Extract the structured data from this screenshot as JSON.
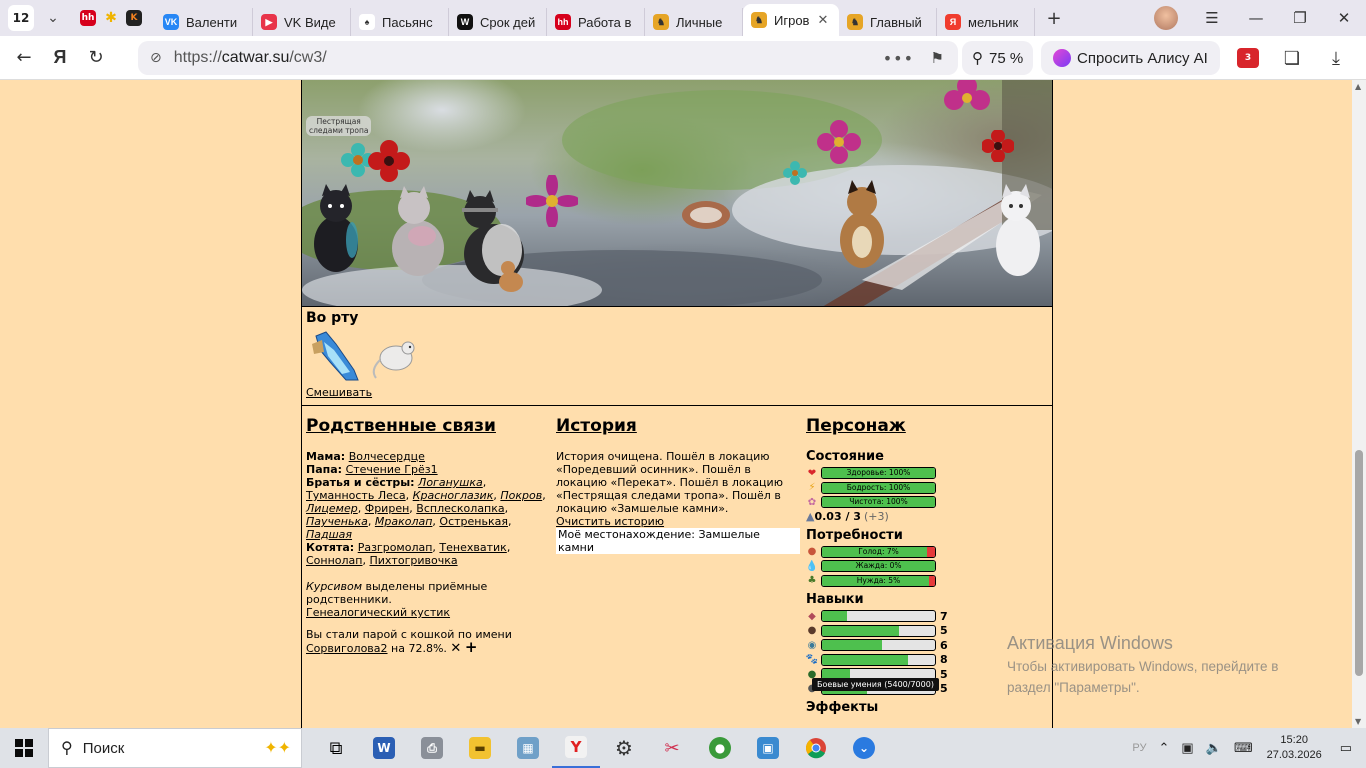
{
  "browser": {
    "tab_count": "12",
    "tabs": [
      {
        "label": "Валенти",
        "fav_color": "#2787f5",
        "fav_text": "VK"
      },
      {
        "label": "VK Виде",
        "fav_color": "#e8344a",
        "fav_text": "▶"
      },
      {
        "label": "Пасьянс",
        "fav_color": "#ffffff",
        "fav_text": "♠"
      },
      {
        "label": "Срок дей",
        "fav_color": "#111111",
        "fav_text": "W"
      },
      {
        "label": "Работа в",
        "fav_color": "#d6001c",
        "fav_text": "hh"
      },
      {
        "label": "Личные",
        "fav_color": "#e6a526",
        "fav_text": "♞"
      },
      {
        "label": "Игров",
        "fav_color": "#e6a526",
        "fav_text": "♞",
        "active": true
      },
      {
        "label": "Главный",
        "fav_color": "#e6a526",
        "fav_text": "♞"
      },
      {
        "label": "мельник",
        "fav_color": "#f03c2e",
        "fav_text": "Я"
      }
    ],
    "url_scheme": "https://",
    "url_host": "catwar.su",
    "url_path": "/cw3/",
    "zoom": "75 %",
    "alice_label": "Спросить Алису AI",
    "ext_badge": "3"
  },
  "scene": {
    "location_label_1": "Пестрящая",
    "location_label_2": "следами тропа"
  },
  "mouth": {
    "title": "Во рту",
    "mix_link": "Смешивать"
  },
  "relations": {
    "title": "Родственные связи",
    "mom_label": "Мама",
    "mom": "Волчесердце",
    "dad_label": "Папа",
    "dad": "Стечение Грёз1",
    "siblings_label": "Братья и сёстры",
    "siblings": [
      {
        "name": "Логанушка",
        "italic": true
      },
      {
        "name": "Туманность Леса",
        "italic": false
      },
      {
        "name": "Красноглазик",
        "italic": true
      },
      {
        "name": "Покров",
        "italic": true
      },
      {
        "name": "Лицемер",
        "italic": true
      },
      {
        "name": "Фрирен",
        "italic": false
      },
      {
        "name": "Всплесколапка",
        "italic": false
      },
      {
        "name": "Паученька",
        "italic": true
      },
      {
        "name": "Мраколап",
        "italic": true
      },
      {
        "name": "Остренькая",
        "italic": false
      },
      {
        "name": "Падшая",
        "italic": true
      }
    ],
    "kittens_label": "Котята",
    "kittens": [
      "Разгромолап",
      "Тенехватик",
      "Соннолап",
      "Пихтогривочка"
    ],
    "note_italic": "Курсивом",
    "note_rest": " выделены приёмные родственники.",
    "tree_link": "Генеалогический кустик",
    "pair_text": "Вы стали парой с кошкой по имени",
    "pair_name": "Сорвиголова2",
    "pair_pct": " на 72.8%.",
    "pair_x": "✕",
    "pair_plus": "+"
  },
  "history": {
    "title": "История",
    "text": "История очищена. Пошёл в локацию «Поредевший осинник». Пошёл в локацию «Перекат». Пошёл в локацию «Пестрящая следами тропа». Пошёл в локацию «Замшелые камни».",
    "clear_link": "Очистить историю",
    "location": "Моё местонахождение: Замшелые камни"
  },
  "character": {
    "title": "Персонаж",
    "state_title": "Состояние",
    "state": [
      {
        "label": "Здоровье: 100%",
        "value": 100,
        "icon": "❤",
        "icon_name": "heart-icon",
        "color": "#d9262c"
      },
      {
        "label": "Бодрость: 100%",
        "value": 100,
        "icon": "⚡",
        "icon_name": "lightning-icon",
        "color": "#e8a317"
      },
      {
        "label": "Чистота: 100%",
        "value": 100,
        "icon": "✿",
        "icon_name": "clean-icon",
        "color": "#c46aa0"
      }
    ],
    "dirt_value": "0.03 / 3",
    "dirt_plus": "(+3)",
    "needs_title": "Потребности",
    "needs": [
      {
        "label": "Голод: 7%",
        "value": 93,
        "icon": "●",
        "icon_name": "food-icon",
        "color": "#c8553a"
      },
      {
        "label": "Жажда: 0%",
        "value": 100,
        "icon": "💧",
        "icon_name": "water-drop-icon",
        "color": "#2a7fd4"
      },
      {
        "label": "Нужда: 5%",
        "value": 95,
        "icon": "♣",
        "icon_name": "need-icon",
        "color": "#4a7a2a"
      }
    ],
    "skills_title": "Навыки",
    "skills": [
      {
        "value": 22,
        "level": "7",
        "icon": "◆",
        "icon_name": "nose-icon",
        "color": "#b04a5a"
      },
      {
        "value": 68,
        "level": "5",
        "icon": "●",
        "icon_name": "dig-icon",
        "color": "#5a3a2a"
      },
      {
        "value": 53,
        "level": "6",
        "icon": "◉",
        "icon_name": "swim-icon",
        "color": "#3a7a9a"
      },
      {
        "value": 76,
        "level": "8",
        "icon": "🐾",
        "icon_name": "paw-icon",
        "color": "#222222"
      },
      {
        "value": 25,
        "level": "5",
        "icon": "●",
        "icon_name": "climb-icon",
        "color": "#2a6a2a"
      },
      {
        "value": 40,
        "level": "5",
        "icon": "●",
        "icon_name": "fight-icon",
        "color": "#555555"
      }
    ],
    "tooltip": "Боевые умения (5400/7000)",
    "effects_title": "Эффекты"
  },
  "windows_activation": {
    "title": "Активация Windows",
    "line1": "Чтобы активировать Windows, перейдите в",
    "line2": "раздел \"Параметры\"."
  },
  "taskbar": {
    "search_label": "Поиск",
    "time": "15:20",
    "date": "27.03.2026",
    "lang": "РУ"
  }
}
